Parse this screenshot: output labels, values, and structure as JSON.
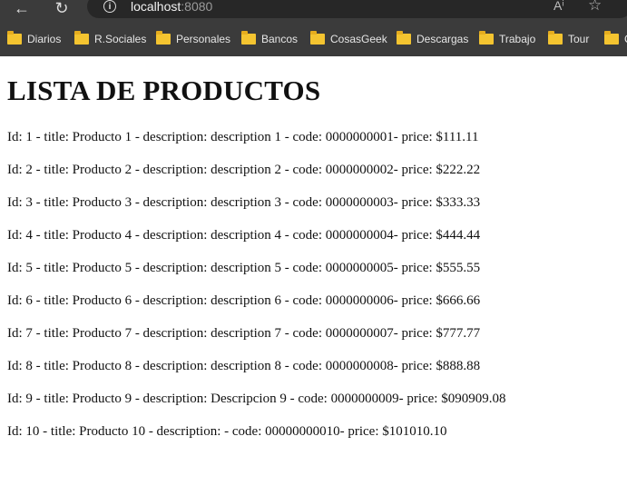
{
  "browser": {
    "url_host": "localhost",
    "url_port": ":8080",
    "icons": {
      "back": "back-arrow-icon",
      "reload": "reload-icon",
      "info": "info-icon",
      "read_aloud": "read-aloud-icon",
      "favorite": "star-icon"
    },
    "bookmarks": [
      {
        "label": "Diarios"
      },
      {
        "label": "R.Sociales"
      },
      {
        "label": "Personales"
      },
      {
        "label": "Bancos"
      },
      {
        "label": "CosasGeek"
      },
      {
        "label": "Descargas"
      },
      {
        "label": "Trabajo"
      },
      {
        "label": "Tour"
      },
      {
        "label": "C"
      }
    ]
  },
  "page": {
    "title": "LISTA DE PRODUCTOS",
    "products": [
      "Id: 1 - title: Producto 1 - description: description 1 - code: 0000000001- price: $111.11",
      "Id: 2 - title: Producto 2 - description: description 2 - code: 0000000002- price: $222.22",
      "Id: 3 - title: Producto 3 - description: description 3 - code: 0000000003- price: $333.33",
      "Id: 4 - title: Producto 4 - description: description 4 - code: 0000000004- price: $444.44",
      "Id: 5 - title: Producto 5 - description: description 5 - code: 0000000005- price: $555.55",
      "Id: 6 - title: Producto 6 - description: description 6 - code: 0000000006- price: $666.66",
      "Id: 7 - title: Producto 7 - description: description 7 - code: 0000000007- price: $777.77",
      "Id: 8 - title: Producto 8 - description: description 8 - code: 0000000008- price: $888.88",
      "Id: 9 - title: Producto 9 - description: Descripcion 9 - code: 0000000009- price: $090909.08",
      "Id: 10 - title: Producto 10 - description: - code: 00000000010- price: $101010.10"
    ]
  }
}
